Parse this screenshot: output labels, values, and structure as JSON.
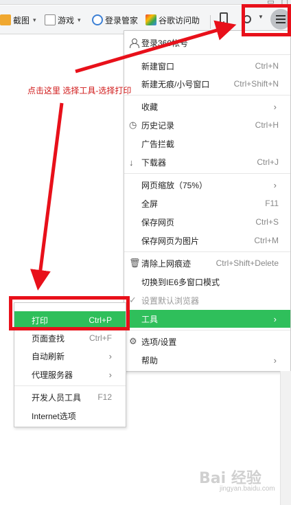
{
  "toolbar": {
    "screenshot_label": "截图",
    "games_label": "游戏",
    "login_manager_label": "登录管家",
    "google_label": "谷歌访问助"
  },
  "main_menu": {
    "items": [
      {
        "label": "登录360帐号",
        "shortcut": ""
      },
      {
        "label": "新建窗口",
        "shortcut": "Ctrl+N"
      },
      {
        "label": "新建无痕/小号窗口",
        "shortcut": "Ctrl+Shift+N"
      },
      {
        "label": "收藏",
        "shortcut": ""
      },
      {
        "label": "历史记录",
        "shortcut": "Ctrl+H"
      },
      {
        "label": "广告拦截",
        "shortcut": ""
      },
      {
        "label": "下载器",
        "shortcut": "Ctrl+J"
      },
      {
        "label": "网页缩放（75%）",
        "shortcut": ""
      },
      {
        "label": "全屏",
        "shortcut": "F11"
      },
      {
        "label": "保存网页",
        "shortcut": "Ctrl+S"
      },
      {
        "label": "保存网页为图片",
        "shortcut": "Ctrl+M"
      },
      {
        "label": "清除上网痕迹",
        "shortcut": "Ctrl+Shift+Delete"
      },
      {
        "label": "切换到IE6多窗口模式",
        "shortcut": ""
      },
      {
        "label": "设置默认浏览器",
        "shortcut": ""
      },
      {
        "label": "工具",
        "shortcut": ""
      },
      {
        "label": "选项/设置",
        "shortcut": ""
      },
      {
        "label": "帮助",
        "shortcut": ""
      }
    ]
  },
  "tools_submenu": {
    "items": [
      {
        "label": "打印",
        "shortcut": "Ctrl+P"
      },
      {
        "label": "页面查找",
        "shortcut": "Ctrl+F"
      },
      {
        "label": "自动刷新",
        "shortcut": ""
      },
      {
        "label": "代理服务器",
        "shortcut": ""
      },
      {
        "label": "开发人员工具",
        "shortcut": "F12"
      },
      {
        "label": "Internet选项",
        "shortcut": ""
      }
    ]
  },
  "annotation": {
    "text": "点击这里   选择工具-选择打印"
  },
  "watermark": {
    "text": "Bai 经验",
    "sub": "jingyan.baidu.com"
  },
  "colors": {
    "highlight_green": "#2fbf5b",
    "annotation_red": "#e8101a"
  }
}
